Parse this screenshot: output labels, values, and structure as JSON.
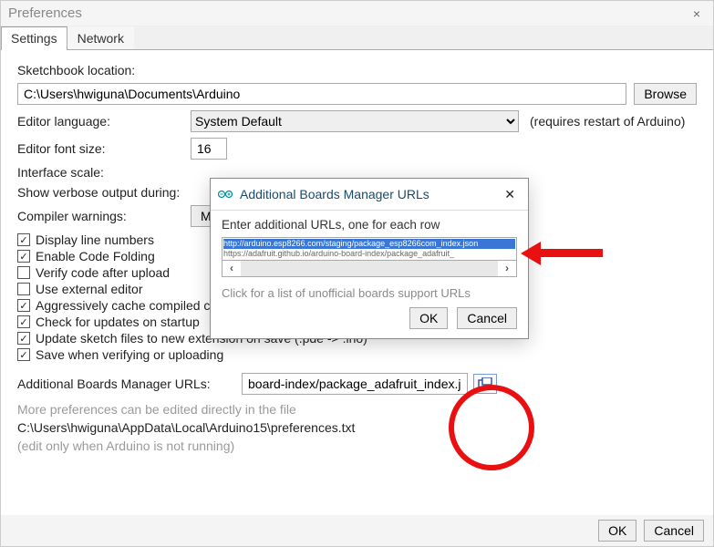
{
  "window": {
    "title": "Preferences",
    "close_label": "×"
  },
  "tabs": {
    "settings": "Settings",
    "network": "Network"
  },
  "labels": {
    "sketchbook": "Sketchbook location:",
    "editor_lang": "Editor language:",
    "font_size": "Editor font size:",
    "interface_scale": "Interface scale:",
    "verbose": "Show verbose output during:",
    "compiler_warnings": "Compiler warnings:",
    "abm_urls": "Additional Boards Manager URLs:",
    "more_prefs": "More preferences can be edited directly in the file",
    "edit_only": "(edit only when Arduino is not running)",
    "restart_note": "(requires restart of Arduino)"
  },
  "values": {
    "sketchbook_path": "C:\\Users\\hwiguna\\Documents\\Arduino",
    "editor_language": "System Default",
    "font_size": "16",
    "compiler_warnings": "Me",
    "abm_url_value": "board-index/package_adafruit_index.json",
    "prefs_file": "C:\\Users\\hwiguna\\AppData\\Local\\Arduino15\\preferences.txt"
  },
  "buttons": {
    "browse": "Browse",
    "ok": "OK",
    "cancel": "Cancel"
  },
  "checkboxes": {
    "display_line_numbers": "Display line numbers",
    "enable_code_folding": "Enable Code Folding",
    "verify_after_upload": "Verify code after upload",
    "external_editor": "Use external editor",
    "aggressive_cache": "Aggressively cache compiled c",
    "check_updates": "Check for updates on startup",
    "update_ext": "Update sketch files to new extension on save (.pde -> .ino)",
    "save_on_verify": "Save when verifying or uploading"
  },
  "dialog": {
    "title": "Additional Boards Manager URLs",
    "prompt": "Enter additional URLs, one for each row",
    "line1": "http://arduino.esp8266.com/staging/package_esp8266com_index.json",
    "line2": "https://adafruit.github.io/arduino-board-index/package_adafruit_",
    "hint": "Click for a list of unofficial boards support URLs",
    "ok": "OK",
    "cancel": "Cancel",
    "scroll_left": "‹",
    "scroll_right": "›"
  }
}
